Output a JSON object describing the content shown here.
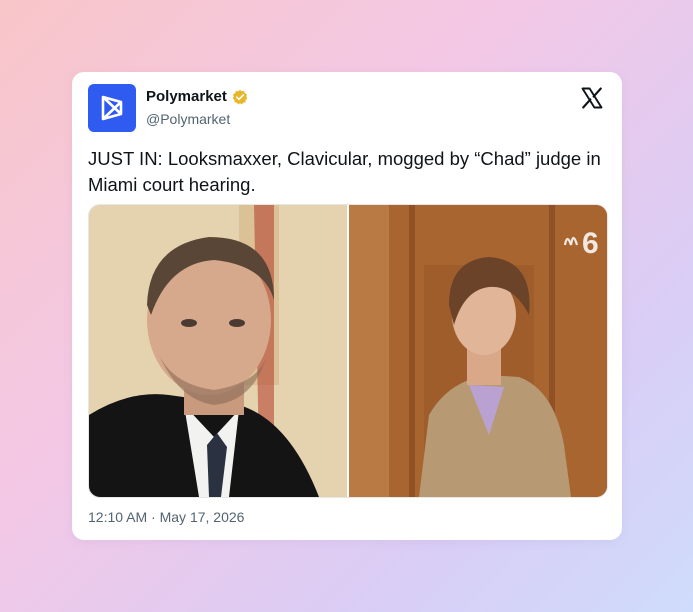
{
  "account": {
    "name": "Polymarket",
    "handle": "@Polymarket",
    "verified": true,
    "avatar_color": "#2f5bf1",
    "verified_color": "#e8b62b"
  },
  "post": {
    "text": "JUST IN: Looksmaxxer, Clavicular, mogged by “Chad” judge in Miami court hearing.",
    "time": "12:10 AM",
    "separator": "·",
    "date": "May 17, 2026"
  },
  "media": {
    "left_image": "judge-photo",
    "right_image": "courtroom-photo",
    "watermark": "6"
  },
  "icons": {
    "platform": "x-logo-icon",
    "badge": "verified-badge-icon"
  }
}
